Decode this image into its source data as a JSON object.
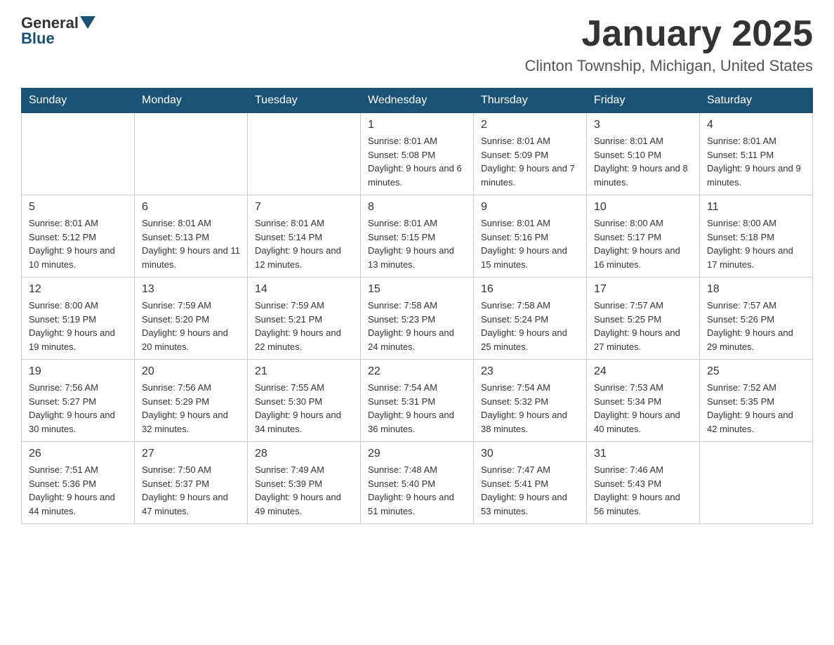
{
  "logo": {
    "general": "General",
    "blue": "Blue"
  },
  "header": {
    "month_year": "January 2025",
    "location": "Clinton Township, Michigan, United States"
  },
  "days_of_week": [
    "Sunday",
    "Monday",
    "Tuesday",
    "Wednesday",
    "Thursday",
    "Friday",
    "Saturday"
  ],
  "weeks": [
    [
      {
        "day": "",
        "info": ""
      },
      {
        "day": "",
        "info": ""
      },
      {
        "day": "",
        "info": ""
      },
      {
        "day": "1",
        "info": "Sunrise: 8:01 AM\nSunset: 5:08 PM\nDaylight: 9 hours and 6 minutes."
      },
      {
        "day": "2",
        "info": "Sunrise: 8:01 AM\nSunset: 5:09 PM\nDaylight: 9 hours and 7 minutes."
      },
      {
        "day": "3",
        "info": "Sunrise: 8:01 AM\nSunset: 5:10 PM\nDaylight: 9 hours and 8 minutes."
      },
      {
        "day": "4",
        "info": "Sunrise: 8:01 AM\nSunset: 5:11 PM\nDaylight: 9 hours and 9 minutes."
      }
    ],
    [
      {
        "day": "5",
        "info": "Sunrise: 8:01 AM\nSunset: 5:12 PM\nDaylight: 9 hours and 10 minutes."
      },
      {
        "day": "6",
        "info": "Sunrise: 8:01 AM\nSunset: 5:13 PM\nDaylight: 9 hours and 11 minutes."
      },
      {
        "day": "7",
        "info": "Sunrise: 8:01 AM\nSunset: 5:14 PM\nDaylight: 9 hours and 12 minutes."
      },
      {
        "day": "8",
        "info": "Sunrise: 8:01 AM\nSunset: 5:15 PM\nDaylight: 9 hours and 13 minutes."
      },
      {
        "day": "9",
        "info": "Sunrise: 8:01 AM\nSunset: 5:16 PM\nDaylight: 9 hours and 15 minutes."
      },
      {
        "day": "10",
        "info": "Sunrise: 8:00 AM\nSunset: 5:17 PM\nDaylight: 9 hours and 16 minutes."
      },
      {
        "day": "11",
        "info": "Sunrise: 8:00 AM\nSunset: 5:18 PM\nDaylight: 9 hours and 17 minutes."
      }
    ],
    [
      {
        "day": "12",
        "info": "Sunrise: 8:00 AM\nSunset: 5:19 PM\nDaylight: 9 hours and 19 minutes."
      },
      {
        "day": "13",
        "info": "Sunrise: 7:59 AM\nSunset: 5:20 PM\nDaylight: 9 hours and 20 minutes."
      },
      {
        "day": "14",
        "info": "Sunrise: 7:59 AM\nSunset: 5:21 PM\nDaylight: 9 hours and 22 minutes."
      },
      {
        "day": "15",
        "info": "Sunrise: 7:58 AM\nSunset: 5:23 PM\nDaylight: 9 hours and 24 minutes."
      },
      {
        "day": "16",
        "info": "Sunrise: 7:58 AM\nSunset: 5:24 PM\nDaylight: 9 hours and 25 minutes."
      },
      {
        "day": "17",
        "info": "Sunrise: 7:57 AM\nSunset: 5:25 PM\nDaylight: 9 hours and 27 minutes."
      },
      {
        "day": "18",
        "info": "Sunrise: 7:57 AM\nSunset: 5:26 PM\nDaylight: 9 hours and 29 minutes."
      }
    ],
    [
      {
        "day": "19",
        "info": "Sunrise: 7:56 AM\nSunset: 5:27 PM\nDaylight: 9 hours and 30 minutes."
      },
      {
        "day": "20",
        "info": "Sunrise: 7:56 AM\nSunset: 5:29 PM\nDaylight: 9 hours and 32 minutes."
      },
      {
        "day": "21",
        "info": "Sunrise: 7:55 AM\nSunset: 5:30 PM\nDaylight: 9 hours and 34 minutes."
      },
      {
        "day": "22",
        "info": "Sunrise: 7:54 AM\nSunset: 5:31 PM\nDaylight: 9 hours and 36 minutes."
      },
      {
        "day": "23",
        "info": "Sunrise: 7:54 AM\nSunset: 5:32 PM\nDaylight: 9 hours and 38 minutes."
      },
      {
        "day": "24",
        "info": "Sunrise: 7:53 AM\nSunset: 5:34 PM\nDaylight: 9 hours and 40 minutes."
      },
      {
        "day": "25",
        "info": "Sunrise: 7:52 AM\nSunset: 5:35 PM\nDaylight: 9 hours and 42 minutes."
      }
    ],
    [
      {
        "day": "26",
        "info": "Sunrise: 7:51 AM\nSunset: 5:36 PM\nDaylight: 9 hours and 44 minutes."
      },
      {
        "day": "27",
        "info": "Sunrise: 7:50 AM\nSunset: 5:37 PM\nDaylight: 9 hours and 47 minutes."
      },
      {
        "day": "28",
        "info": "Sunrise: 7:49 AM\nSunset: 5:39 PM\nDaylight: 9 hours and 49 minutes."
      },
      {
        "day": "29",
        "info": "Sunrise: 7:48 AM\nSunset: 5:40 PM\nDaylight: 9 hours and 51 minutes."
      },
      {
        "day": "30",
        "info": "Sunrise: 7:47 AM\nSunset: 5:41 PM\nDaylight: 9 hours and 53 minutes."
      },
      {
        "day": "31",
        "info": "Sunrise: 7:46 AM\nSunset: 5:43 PM\nDaylight: 9 hours and 56 minutes."
      },
      {
        "day": "",
        "info": ""
      }
    ]
  ]
}
